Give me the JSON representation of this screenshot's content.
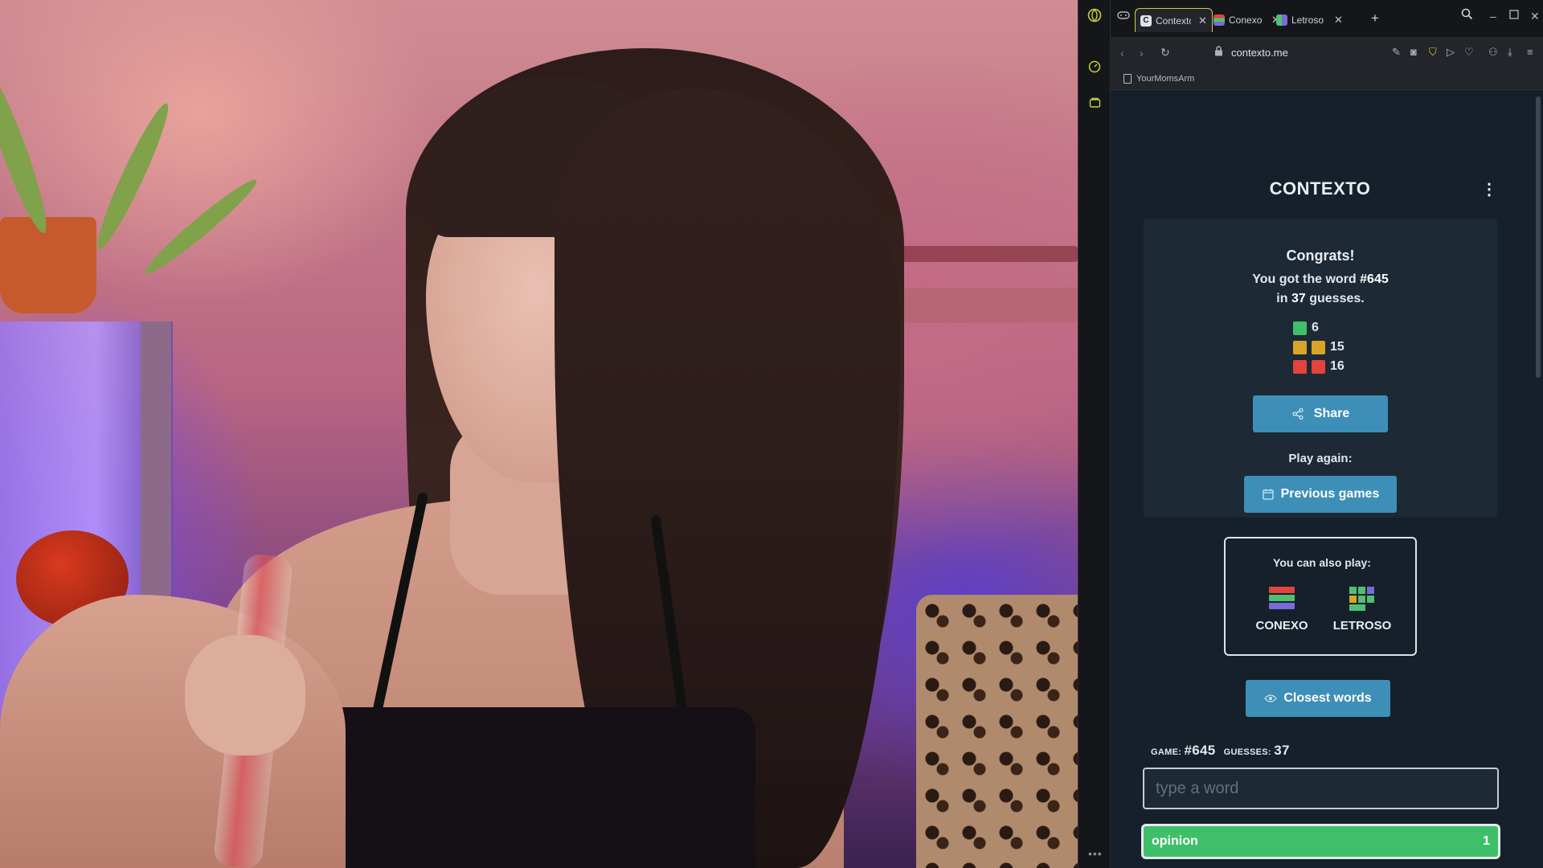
{
  "browser": {
    "tabs": [
      {
        "label": "Contexto",
        "favicon_color": "#dfe3e7",
        "active": true
      },
      {
        "label": "Conexo",
        "favicon_color": "#7a6ad8",
        "active": false
      },
      {
        "label": "Letroso",
        "favicon_color": "#4fbf72",
        "active": false
      }
    ],
    "url": "contexto.me",
    "bookmark": "YourMomsArm",
    "accent_color": "#c6d23c"
  },
  "page": {
    "title": "CONTEXTO",
    "card": {
      "congrats": "Congrats!",
      "got_prefix": "You got the word",
      "word_number": "#645",
      "in_prefix": "in",
      "guesses_count": "37",
      "guesses_suffix": "guesses.",
      "stats": [
        {
          "color": "#3fbf6a",
          "squares": 1,
          "value": "6"
        },
        {
          "color": "#d9a528",
          "squares": 2,
          "value": "15"
        },
        {
          "color": "#e2433c",
          "squares": 2,
          "value": "16"
        }
      ],
      "share_label": "Share",
      "play_again_label": "Play again:",
      "previous_games_label": "Previous games"
    },
    "also_play": {
      "title": "You can also play:",
      "games": [
        "CONEXO",
        "LETROSO"
      ]
    },
    "closest_words_label": "Closest words",
    "status": {
      "game_label": "GAME:",
      "game_value": "#645",
      "guesses_label": "GUESSES:",
      "guesses_value": "37"
    },
    "input_placeholder": "type a word",
    "guess": {
      "word": "opinion",
      "rank": "1",
      "color": "#3fbf6a"
    }
  }
}
